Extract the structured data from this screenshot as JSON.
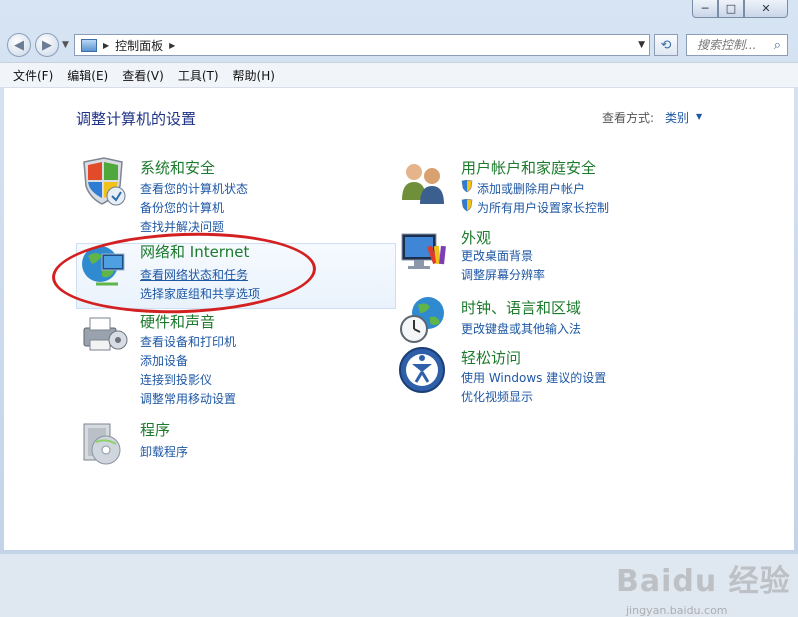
{
  "window": {
    "controls": {
      "minimize": "─",
      "maximize": "□",
      "close": "✕"
    }
  },
  "nav": {
    "breadcrumb": "控制面板",
    "search_placeholder": "搜索控制...",
    "icons": {
      "back": "arrow-left",
      "forward": "arrow-right",
      "refresh": "refresh",
      "search": "magnifier"
    }
  },
  "menu": [
    "文件(F)",
    "编辑(E)",
    "查看(V)",
    "工具(T)",
    "帮助(H)"
  ],
  "page": {
    "heading": "调整计算机的设置",
    "view_mode_label": "查看方式:",
    "view_mode_value": "类别"
  },
  "categories": {
    "system": {
      "title": "系统和安全",
      "links": [
        "查看您的计算机状态",
        "备份您的计算机",
        "查找并解决问题"
      ]
    },
    "network": {
      "title": "网络和 Internet",
      "links": [
        "查看网络状态和任务",
        "选择家庭组和共享选项"
      ]
    },
    "hardware": {
      "title": "硬件和声音",
      "links": [
        "查看设备和打印机",
        "添加设备",
        "连接到投影仪",
        "调整常用移动设置"
      ]
    },
    "programs": {
      "title": "程序",
      "links": [
        "卸载程序"
      ]
    },
    "users": {
      "title": "用户帐户和家庭安全",
      "links": [
        "添加或删除用户帐户",
        "为所有用户设置家长控制"
      ]
    },
    "appearance": {
      "title": "外观",
      "links": [
        "更改桌面背景",
        "调整屏幕分辨率"
      ]
    },
    "clock": {
      "title": "时钟、语言和区域",
      "links": [
        "更改键盘或其他输入法"
      ]
    },
    "ease": {
      "title": "轻松访问",
      "links": [
        "使用 Windows 建议的设置",
        "优化视频显示"
      ]
    }
  },
  "watermark": {
    "main": "Baidu 经验",
    "sub": "jingyan.baidu.com"
  },
  "colors": {
    "category_title": "#1b7a2b",
    "link": "#1e57a4",
    "heading": "#1e3287",
    "annotation": "#d32020"
  }
}
